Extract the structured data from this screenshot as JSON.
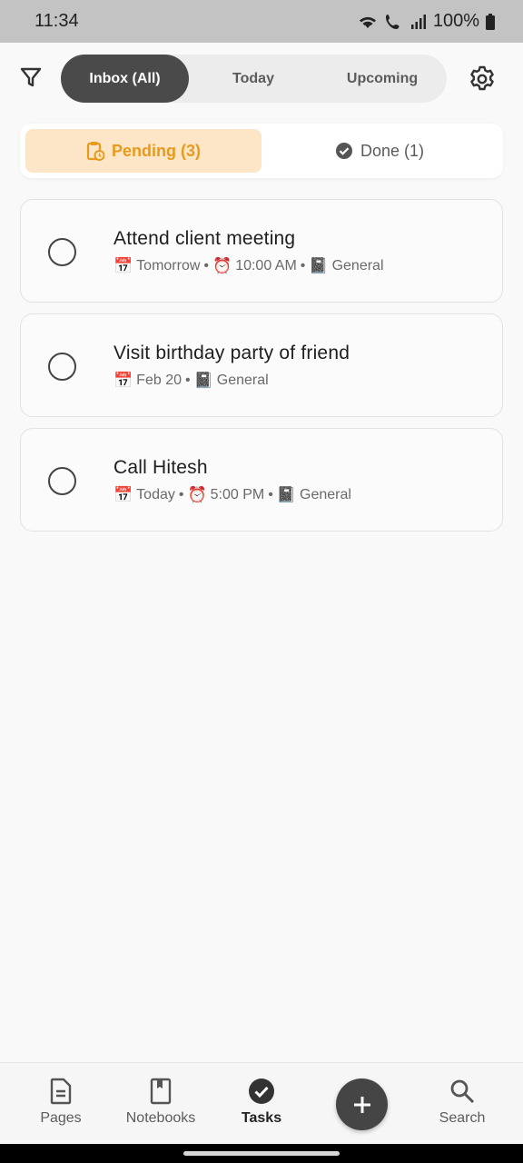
{
  "status_bar": {
    "time": "11:34",
    "battery": "100%"
  },
  "tabs": [
    {
      "label": "Inbox (All)",
      "active": true
    },
    {
      "label": "Today",
      "active": false
    },
    {
      "label": "Upcoming",
      "active": false
    }
  ],
  "status_tabs": {
    "pending_label": "Pending (3)",
    "done_label": "Done (1)"
  },
  "tasks": [
    {
      "title": "Attend client meeting",
      "date": "Tomorrow",
      "time": "10:00 AM",
      "notebook": "General"
    },
    {
      "title": "Visit birthday party of friend",
      "date": "Feb 20",
      "notebook": "General"
    },
    {
      "title": "Call Hitesh",
      "date": "Today",
      "time": "5:00 PM",
      "notebook": "General"
    }
  ],
  "separator": "•",
  "bottom_nav": [
    {
      "label": "Pages",
      "icon": "page-icon"
    },
    {
      "label": "Notebooks",
      "icon": "notebook-icon"
    },
    {
      "label": "Tasks",
      "icon": "check-circle-icon",
      "active": true
    },
    {
      "label": "Search",
      "icon": "search-icon"
    }
  ],
  "colors": {
    "accent": "#e79a1c",
    "accent_bg": "#fde6c8",
    "active_tab_bg": "#4a4a4a"
  }
}
